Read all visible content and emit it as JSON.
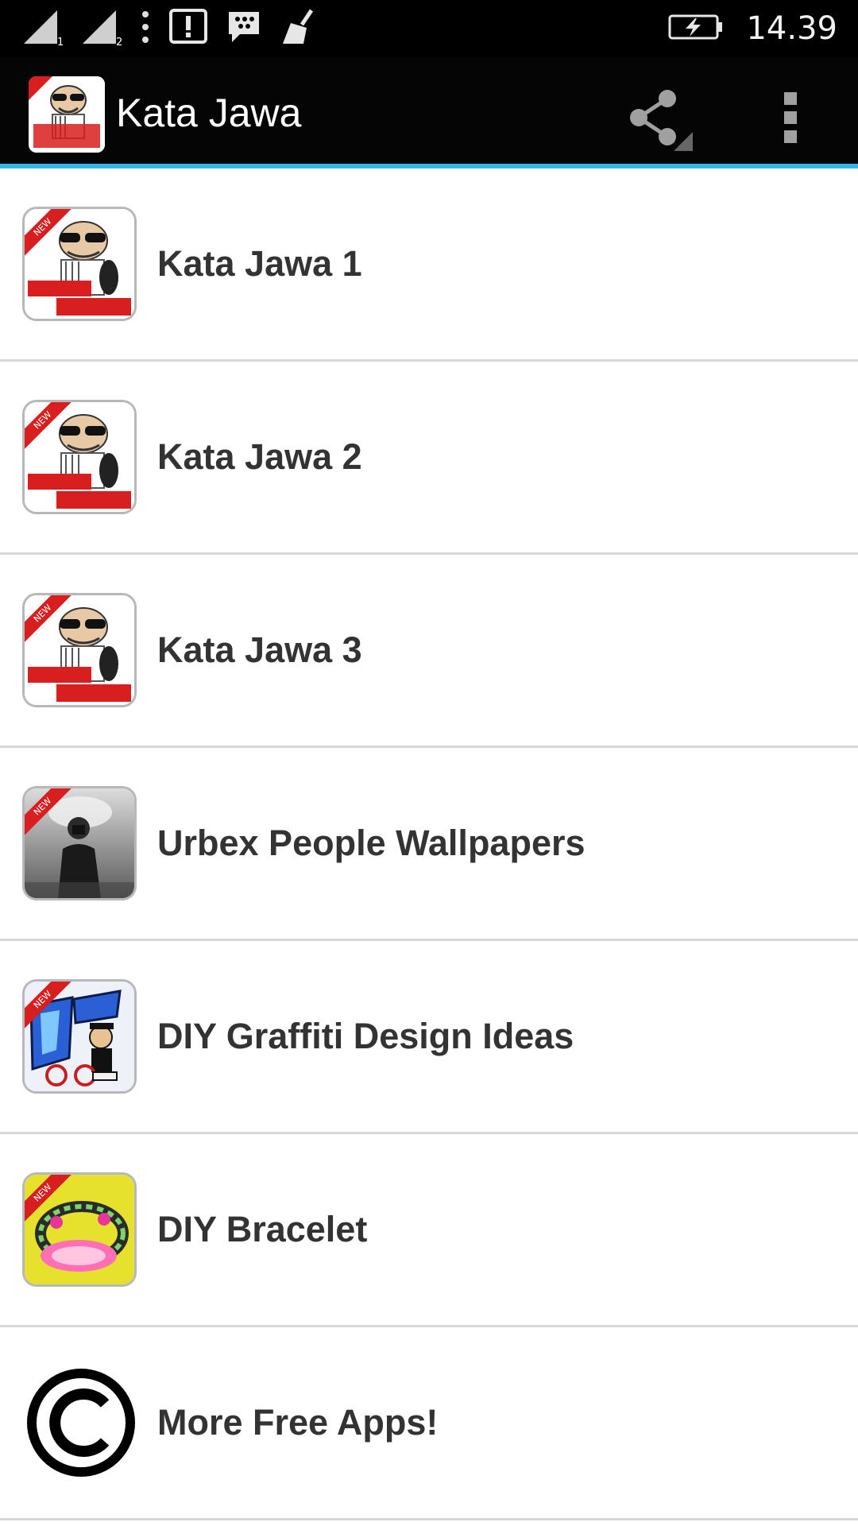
{
  "status_bar": {
    "time": "14.39",
    "sim1_label": "1",
    "sim2_label": "2",
    "icons": [
      "signal-sim1-icon",
      "signal-sim2-icon",
      "more-notifications-icon",
      "alert-icon",
      "bbm-chat-icon",
      "cleaner-broom-icon",
      "battery-charging-icon"
    ]
  },
  "action_bar": {
    "title": "Kata Jawa",
    "icon": "kata-jawa-app-icon",
    "share_icon": "share-icon",
    "overflow_icon": "overflow-menu-icon",
    "accent_color": "#33b5e5"
  },
  "thumb_badge": "NEW",
  "list": [
    {
      "label": "Kata Jawa 1",
      "icon": "kata-jawa-icon"
    },
    {
      "label": "Kata Jawa 2",
      "icon": "kata-jawa-icon"
    },
    {
      "label": "Kata Jawa 3",
      "icon": "kata-jawa-icon"
    },
    {
      "label": "Urbex People Wallpapers",
      "icon": "urbex-wallpapers-icon"
    },
    {
      "label": "DIY Graffiti Design Ideas",
      "icon": "graffiti-icon"
    },
    {
      "label": "DIY Bracelet",
      "icon": "bracelet-icon"
    },
    {
      "label": "More Free Apps!",
      "icon": "copyright-icon"
    }
  ]
}
